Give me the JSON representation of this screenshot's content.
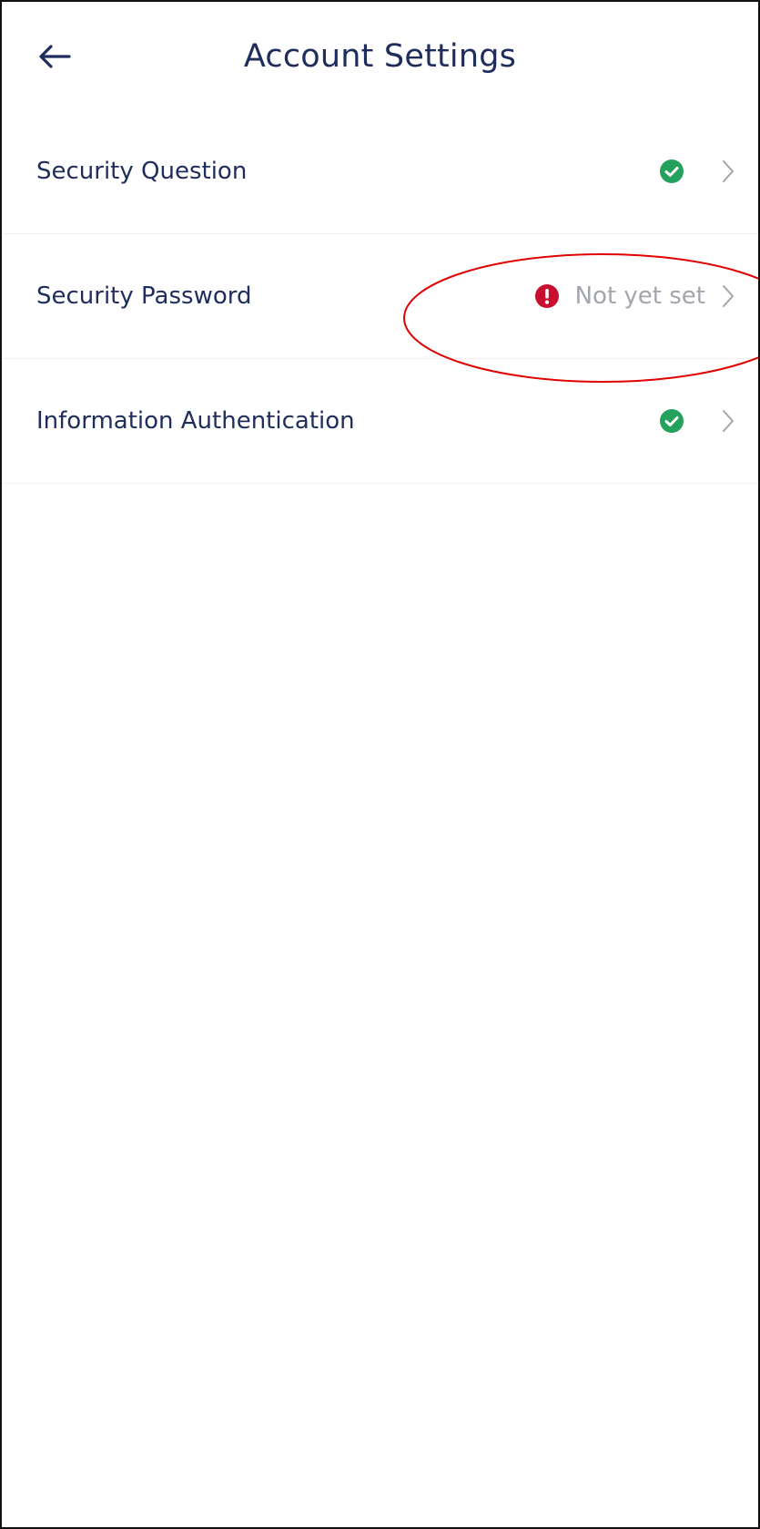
{
  "header": {
    "title": "Account Settings",
    "back_icon": "arrow-left-icon"
  },
  "settings": {
    "items": [
      {
        "label": "Security Question",
        "status": "verified",
        "status_icon": "check-circle-icon",
        "status_color": "#23a15d"
      },
      {
        "label": "Security Password",
        "status": "warning",
        "status_icon": "exclamation-circle-icon",
        "status_color": "#c8102e",
        "status_text": "Not yet set"
      },
      {
        "label": "Information Authentication",
        "status": "verified",
        "status_icon": "check-circle-icon",
        "status_color": "#23a15d"
      }
    ]
  },
  "annotation": {
    "shape": "ellipse",
    "color": "#e00000"
  },
  "colors": {
    "text_primary": "#1f2d5c",
    "text_muted": "#a2a5ad",
    "success": "#23a15d",
    "danger": "#c8102e",
    "divider": "#f1f1f3"
  }
}
